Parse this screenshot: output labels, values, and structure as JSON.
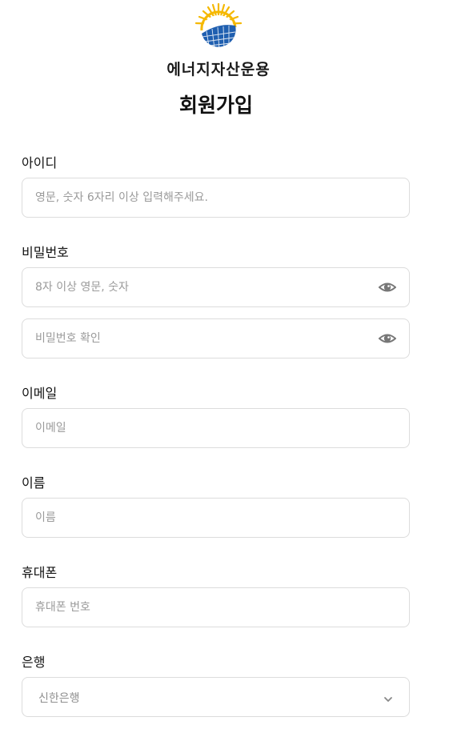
{
  "brand": {
    "name": "에너지자산운용"
  },
  "page": {
    "title": "회원가입"
  },
  "form": {
    "id": {
      "label": "아이디",
      "placeholder": "영문, 숫자 6자리 이상 입력해주세요.",
      "value": ""
    },
    "password": {
      "label": "비밀번호",
      "placeholder": "8자 이상 영문, 숫자",
      "confirm_placeholder": "비밀번호 확인",
      "value": "",
      "confirm_value": ""
    },
    "email": {
      "label": "이메일",
      "placeholder": "이메일",
      "value": ""
    },
    "name": {
      "label": "이름",
      "placeholder": "이름",
      "value": ""
    },
    "phone": {
      "label": "휴대폰",
      "placeholder": "휴대폰 번호",
      "value": ""
    },
    "bank": {
      "label": "은행",
      "selected": "신한은행"
    }
  },
  "icons": {
    "eye": "eye-icon",
    "chevron": "chevron-down-icon",
    "logo": "solar-sun-panel-logo"
  },
  "colors": {
    "border": "#dcdcdc",
    "placeholder": "#9a9a9a",
    "text": "#111111",
    "logo_blue": "#1f5fb0",
    "logo_yellow": "#f5b800"
  }
}
